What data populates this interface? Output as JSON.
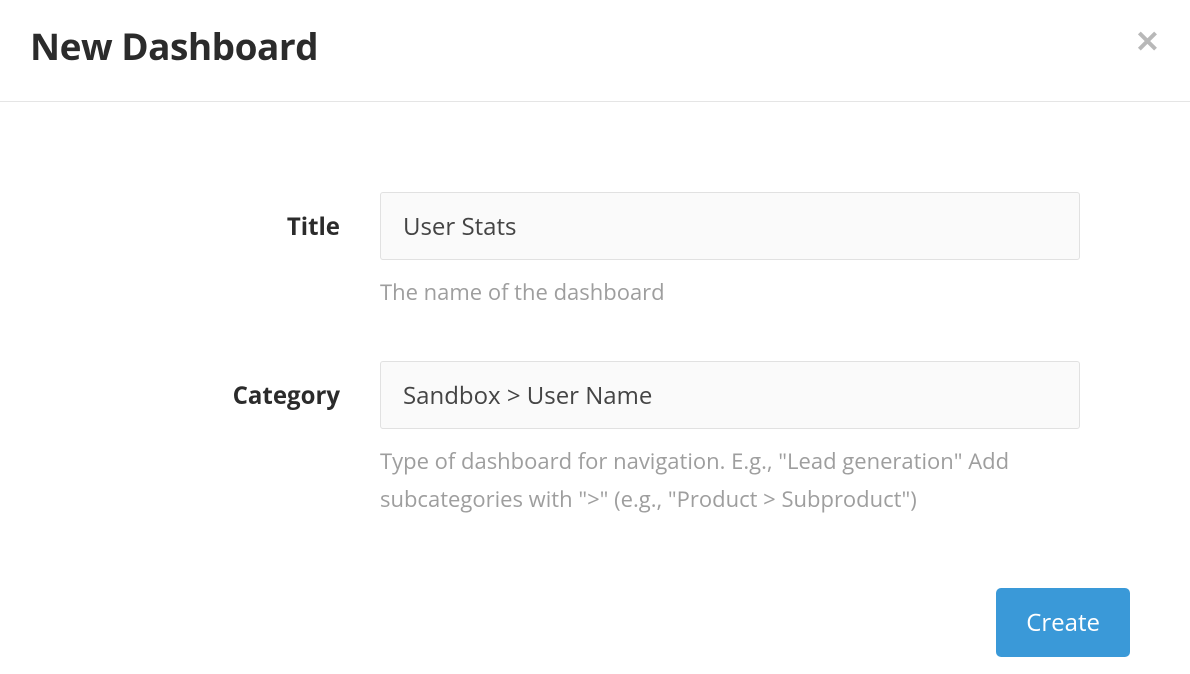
{
  "header": {
    "title": "New Dashboard"
  },
  "form": {
    "title": {
      "label": "Title",
      "value": "User Stats",
      "help": "The name of the dashboard"
    },
    "category": {
      "label": "Category",
      "value": "Sandbox > User Name",
      "help": "Type of dashboard for navigation. E.g., \"Lead generation\" Add subcategories with \">\" (e.g., \"Product > Subproduct\")"
    }
  },
  "footer": {
    "create_label": "Create"
  }
}
